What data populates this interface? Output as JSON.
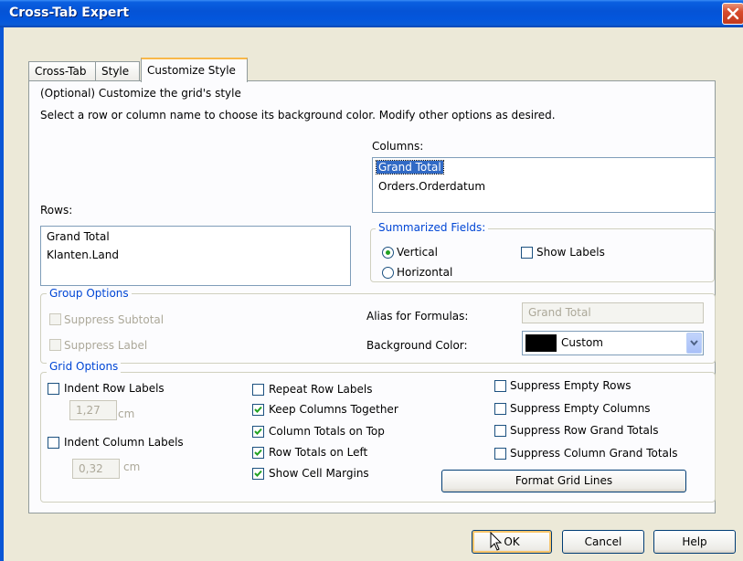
{
  "window": {
    "title": "Cross-Tab Expert"
  },
  "tabs": [
    {
      "label": "Cross-Tab"
    },
    {
      "label": "Style"
    },
    {
      "label": "Customize Style"
    }
  ],
  "intro": {
    "line1": "(Optional) Customize the grid's style",
    "line2": "Select a row or column name to choose its background color.  Modify other options as desired."
  },
  "columns": {
    "label": "Columns:",
    "items": [
      "Grand Total",
      "Orders.Orderdatum"
    ]
  },
  "rows": {
    "label": "Rows:",
    "items": [
      "Grand Total",
      "Klanten.Land"
    ]
  },
  "summarized": {
    "title": "Summarized Fields:",
    "vertical": "Vertical",
    "horizontal": "Horizontal",
    "show_labels": "Show Labels",
    "selected": "Vertical"
  },
  "group_options": {
    "title": "Group Options",
    "suppress_subtotal": "Suppress Subtotal",
    "suppress_label": "Suppress Label",
    "alias_label": "Alias for Formulas:",
    "alias_value": "Grand Total",
    "bg_label": "Background Color:",
    "bg_value": "Custom",
    "bg_color": "#000000"
  },
  "grid_options": {
    "title": "Grid  Options",
    "indent_row_labels": "Indent Row Labels",
    "indent_row_value": "1,27",
    "indent_col_labels": "Indent Column Labels",
    "indent_col_value": "0,32",
    "unit": "cm",
    "repeat_row_labels": "Repeat Row Labels",
    "keep_columns_together": "Keep Columns Together",
    "column_totals_on_top": "Column Totals on Top",
    "row_totals_on_left": "Row Totals on Left",
    "show_cell_margins": "Show Cell Margins",
    "suppress_empty_rows": "Suppress Empty Rows",
    "suppress_empty_columns": "Suppress Empty Columns",
    "suppress_row_grand_totals": "Suppress Row Grand Totals",
    "suppress_column_grand_totals": "Suppress Column Grand Totals",
    "format_grid_lines": "Format Grid Lines"
  },
  "buttons": {
    "ok": "OK",
    "cancel": "Cancel",
    "help": "Help"
  },
  "colors": {
    "accent": "#0046D5",
    "titlebar": "#0553D6",
    "close": "#D84B2C",
    "check": "#21A121"
  },
  "icons": {
    "close": "close-icon",
    "check": "checkmark-icon",
    "dropdown": "chevron-down-icon",
    "cursor": "mouse-pointer-icon"
  }
}
